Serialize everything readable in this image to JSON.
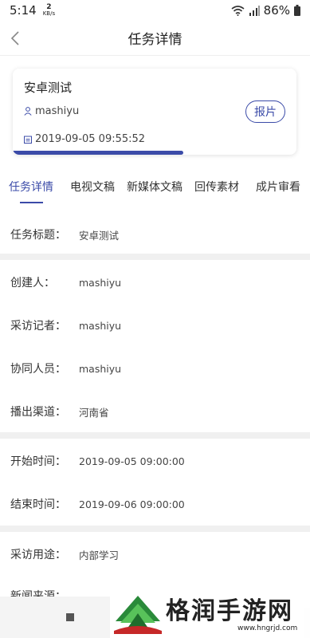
{
  "status_bar": {
    "time": "5:14",
    "speed_top": "2",
    "speed_unit": "KB/s",
    "battery": "86%"
  },
  "nav": {
    "title": "任务详情",
    "back_icon": "chevron-left-icon"
  },
  "task_card": {
    "name": "安卓测试",
    "creator": "mashiyu",
    "date": "2019-09-05 09:55:52",
    "report_button": "报片",
    "progress": 0.6,
    "accent_color": "#3b4ba8"
  },
  "tabs": [
    {
      "label": "任务详情",
      "active": true
    },
    {
      "label": "电视文稿",
      "active": false
    },
    {
      "label": "新媒体文稿",
      "active": false
    },
    {
      "label": "回传素材",
      "active": false
    },
    {
      "label": "成片审看",
      "active": false
    }
  ],
  "details": {
    "task_title": {
      "label": "任务标题：",
      "value": "安卓测试"
    },
    "creator": {
      "label": "创建人：",
      "value": "mashiyu"
    },
    "reporter": {
      "label": "采访记者：",
      "value": "mashiyu"
    },
    "collaborators": {
      "label": "协同人员：",
      "value": "mashiyu"
    },
    "channel": {
      "label": "播出渠道：",
      "value": "河南省"
    },
    "start_time": {
      "label": "开始时间：",
      "value": "2019-09-05 09:00:00"
    },
    "end_time": {
      "label": "结束时间：",
      "value": "2019-09-06 09:00:00"
    },
    "purpose": {
      "label": "采访用途：",
      "value": "内部学习"
    },
    "news_source": {
      "label": "新闻来源："
    }
  },
  "watermark": {
    "text": "格润手游网",
    "url": "www.hngrjd.com"
  }
}
